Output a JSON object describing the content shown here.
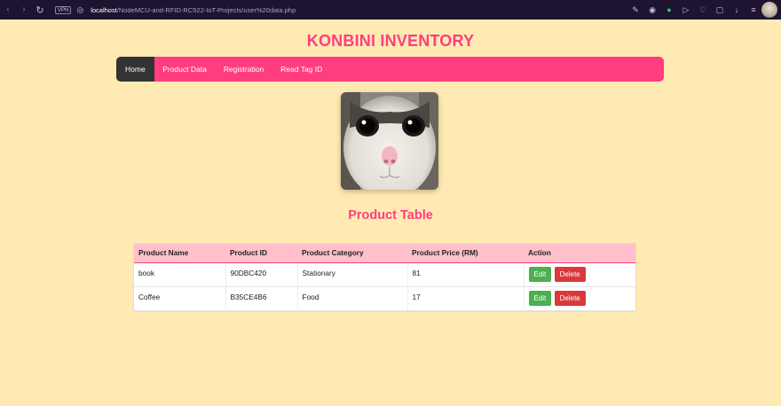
{
  "browser": {
    "url_host": "localhost",
    "url_path": "/NodeMCU-and-RFID-RC522-IoT-Projects/user%20data.php",
    "vpn_label": "VPN"
  },
  "page": {
    "title": "KONBINI INVENTORY",
    "subtitle": "Product Table"
  },
  "nav": {
    "items": [
      "Home",
      "Product Data",
      "Registration",
      "Read Tag ID"
    ],
    "active": "Home"
  },
  "table": {
    "headers": [
      "Product Name",
      "Product ID",
      "Product Category",
      "Product Price (RM)",
      "Action"
    ],
    "rows": [
      {
        "name": "book",
        "id": "90DBC420",
        "category": "Stationary",
        "price": "81"
      },
      {
        "name": "Coffee",
        "id": "B35CE4B6",
        "category": "Food",
        "price": "17"
      }
    ],
    "edit_label": "Edit",
    "delete_label": "Delete"
  },
  "colors": {
    "accent": "#ff3d7f",
    "page_bg": "#ffeab3",
    "header_bg": "#ffc0cb",
    "edit": "#4caf50",
    "delete": "#d9393b"
  }
}
